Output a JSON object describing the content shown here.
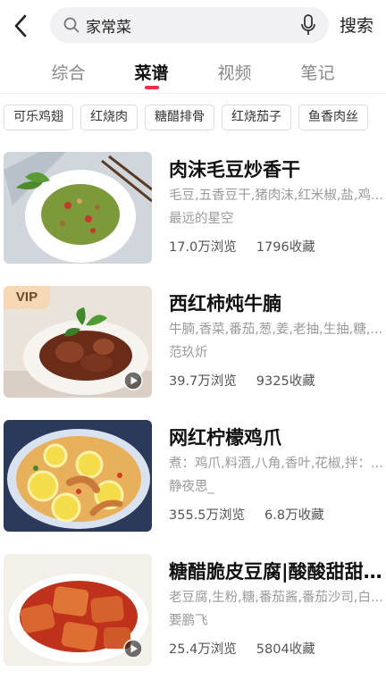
{
  "header": {
    "back_icon": "chevron-left-icon",
    "search_icon": "search-icon",
    "mic_icon": "microphone-icon",
    "search_value": "家常菜",
    "search_button": "搜索"
  },
  "tabs": [
    {
      "label": "综合",
      "active": false
    },
    {
      "label": "菜谱",
      "active": true
    },
    {
      "label": "视频",
      "active": false
    },
    {
      "label": "笔记",
      "active": false
    }
  ],
  "accent_color": "#ee2d4f",
  "chips": [
    "可乐鸡翅",
    "红烧肉",
    "糖醋排骨",
    "红烧茄子",
    "鱼香肉丝"
  ],
  "recipes": [
    {
      "title": "肉沫毛豆炒香干",
      "ingredients": "毛豆,五香豆干,猪肉沫,红米椒,盐,鸡...",
      "author": "最远的星空",
      "views": "17.0万浏览",
      "favorites": "1796收藏",
      "vip": "",
      "video": false
    },
    {
      "title": "西红柿炖牛腩",
      "ingredients": "牛腩,香菜,番茄,葱,姜,老抽,生抽,糖,...",
      "author": "范玖炘",
      "views": "39.7万浏览",
      "favorites": "9325收藏",
      "vip": "VIP",
      "video": true
    },
    {
      "title": "网红柠檬鸡爪",
      "ingredients": "煮：鸡爪,料酒,八角,香叶,花椒,拌：...",
      "author": "静夜思_",
      "views": "355.5万浏览",
      "favorites": "6.8万收藏",
      "vip": "",
      "video": false
    },
    {
      "title": "糖醋脆皮豆腐|酸酸甜甜...",
      "ingredients": "老豆腐,生粉,糖,番茄酱,番茄沙司,白...",
      "author": "要鹏飞",
      "views": "25.4万浏览",
      "favorites": "5804收藏",
      "vip": "",
      "video": true
    }
  ]
}
